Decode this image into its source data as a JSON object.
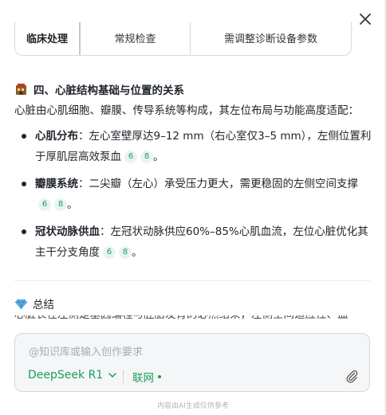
{
  "close": {
    "icon": "close-icon"
  },
  "table_row": {
    "cells": [
      "临床处理",
      "常规检查",
      "需调整诊断设备参数"
    ]
  },
  "section": {
    "icon": "heart-building-icon",
    "title": "四、心脏结构基础与位置的关系",
    "intro": "心脏由心肌细胞、瓣膜、传导系统等构成，其左位布局与功能高度适配：",
    "points": [
      {
        "term": "心肌分布",
        "text": "：左心室壁厚达9–12 mm（右心室仅3–5 mm），左侧位置利于厚肌层高效泵血",
        "refs": [
          "6",
          "8"
        ]
      },
      {
        "term": "瓣膜系统",
        "text": "：二尖瓣（左心）承受压力更大，需更稳固的左侧空间支撑",
        "refs": [
          "6",
          "8"
        ]
      },
      {
        "term": "冠状动脉供血",
        "text": "：左冠状动脉供应60%–85%心肌血流，左位心脏优化其主干分支角度",
        "refs": [
          "6",
          "8"
        ]
      }
    ]
  },
  "summary": {
    "icon": "gem-icon",
    "label": "总结",
    "cut_text": "心脏长在左侧是基因编程与胚胎发育的必然结果，左侧空间适应性、血"
  },
  "composer": {
    "placeholder": "@知识库或输入创作要求",
    "model": "DeepSeek R1",
    "web": "联网"
  },
  "footer": "内容由AI生成仅供参考",
  "colors": {
    "accent": "#1a9e5b",
    "cite_bg": "#e8f5ee"
  }
}
